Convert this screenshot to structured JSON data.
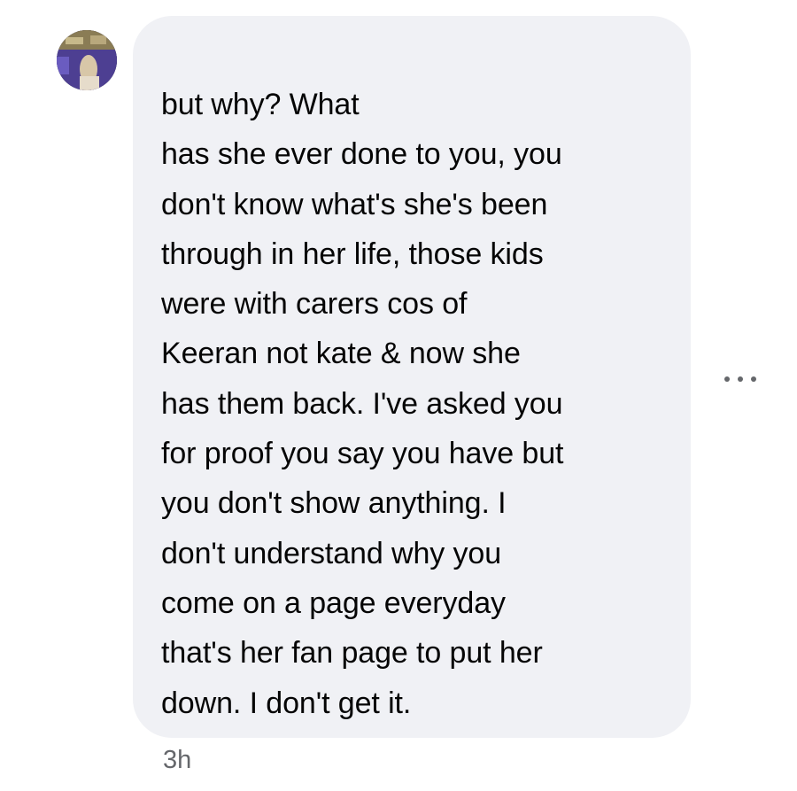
{
  "comment": {
    "text": "                                   but why? What\nhas she ever done to you, you\ndon't know what's she's been\nthrough in her life, those kids\nwere with carers cos of\nKeeran not kate & now she\nhas them back. I've asked you\nfor proof you say you have but\nyou don't show anything. I\ndon't understand why you\ncome on a page everyday\nthat's her fan page to put her\ndown. I don't get it.",
    "timestamp": "3h"
  },
  "avatar": {
    "icon": "user-avatar-photo"
  },
  "actions": {
    "more_icon": "more-options-icon"
  },
  "colors": {
    "bubble": "#f0f1f5",
    "text": "#050505",
    "meta": "#65676b"
  }
}
